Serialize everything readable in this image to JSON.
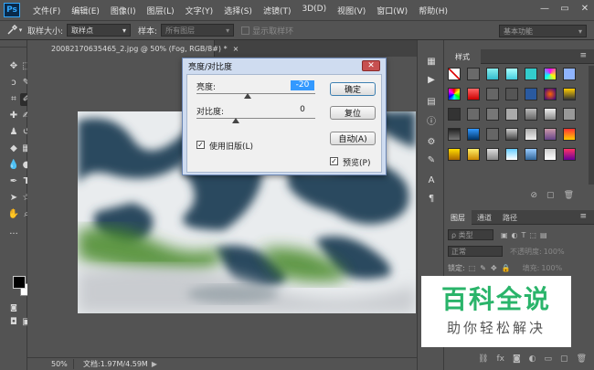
{
  "app": {
    "logo": "Ps"
  },
  "menu": [
    "文件(F)",
    "编辑(E)",
    "图像(I)",
    "图层(L)",
    "文字(Y)",
    "选择(S)",
    "滤镜(T)",
    "3D(D)",
    "视图(V)",
    "窗口(W)",
    "帮助(H)"
  ],
  "window_controls": {
    "minimize": "—",
    "restore": "▭",
    "close": "✕"
  },
  "options_bar": {
    "sample_size_label": "取样大小:",
    "sample_size_value": "取样点",
    "sample_label": "样本:",
    "sample_value": "所有图层",
    "show_ring_label": "显示取样环",
    "workspace": "基本功能"
  },
  "document": {
    "tab_title": "20082170635465_2.jpg @ 50% (Fog, RGB/8#) *",
    "tab_close": "×",
    "zoom": "50%",
    "doc_info": "文档:1.97M/4.59M",
    "status_arrow": "▶"
  },
  "dialog": {
    "title": "亮度/对比度",
    "close": "✕",
    "brightness_label": "亮度:",
    "brightness_value": "-20",
    "contrast_label": "对比度:",
    "contrast_value": "0",
    "brightness_level": -20,
    "contrast_level": 0,
    "legacy_label": "使用旧版(L)",
    "legacy_checked": true,
    "preview_label": "预览(P)",
    "preview_checked": true,
    "ok": "确定",
    "reset": "复位",
    "auto": "自动(A)"
  },
  "styles_panel": {
    "tab": "样式"
  },
  "layers_panel": {
    "tabs": [
      "图层",
      "通道",
      "路径"
    ],
    "filter_label": "ρ 类型",
    "blend_mode": "正常",
    "opacity_label": "不透明度:",
    "opacity_value": "100%",
    "lock_label": "锁定:",
    "fill_label": "填充:",
    "fill_value": "100%"
  },
  "watermark": {
    "title": "百科全说",
    "subtitle": "助你轻松解决"
  },
  "colors": {
    "accent": "#31a8ff",
    "watermark_green": "#2ab46a",
    "ui_bg": "#535353"
  }
}
